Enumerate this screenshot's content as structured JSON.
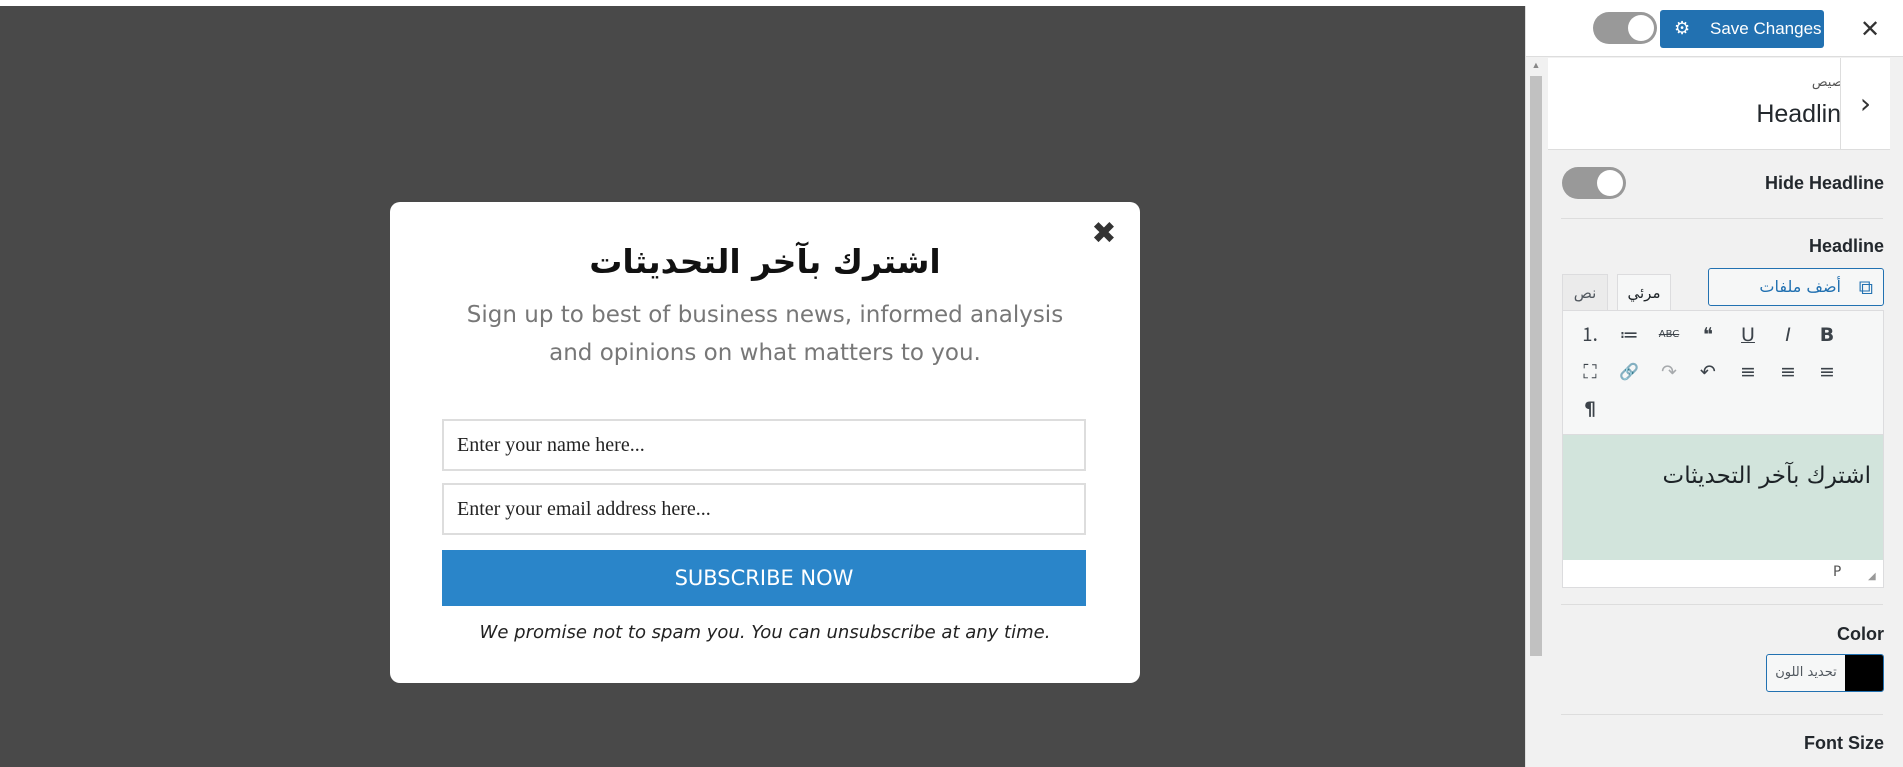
{
  "modal": {
    "close_symbol": "✖",
    "title": "اشترك بآخر التحديثات",
    "subtitle": "Sign up to best of business news, informed analysis and opinions on what matters to you.",
    "name_placeholder": "Enter your name here...",
    "email_placeholder": "Enter your email address here...",
    "subscribe_label": "SUBSCRIBE NOW",
    "promise_text": "We promise not to spam you. You can unsubscribe at any time."
  },
  "header": {
    "save_label": "Save Changes",
    "gear_icon": "⚙",
    "close_symbol": "✕"
  },
  "section": {
    "breadcrumb": "تخصيص",
    "title": "Headline",
    "back_symbol": "›"
  },
  "controls": {
    "hide_headline_label": "Hide Headline",
    "headline_label": "Headline",
    "add_media_label": "أضف ملفات وسائط",
    "add_media_icon": "⧉",
    "tab_visual": "مرئي",
    "tab_text": "نص",
    "editor_content": "اشترك بآخر التحديثات",
    "status_path": "P",
    "color_label": "Color",
    "select_color_label": "تحديد اللون",
    "color_value": "#000000",
    "font_size_label": "Font Size"
  },
  "toolbar": {
    "row1": [
      "⒈",
      "≔",
      "ABC",
      "❝",
      "U",
      "I",
      "B"
    ],
    "row2": [
      "⛶",
      "🔗",
      "↷",
      "↶",
      "≡",
      "≡",
      "≡"
    ],
    "row3": [
      "¶"
    ]
  },
  "colors": {
    "accent": "#2271b1",
    "subscribe": "#2a85c9",
    "overlay": "#494949",
    "editor_bg": "#d2e4dc"
  }
}
